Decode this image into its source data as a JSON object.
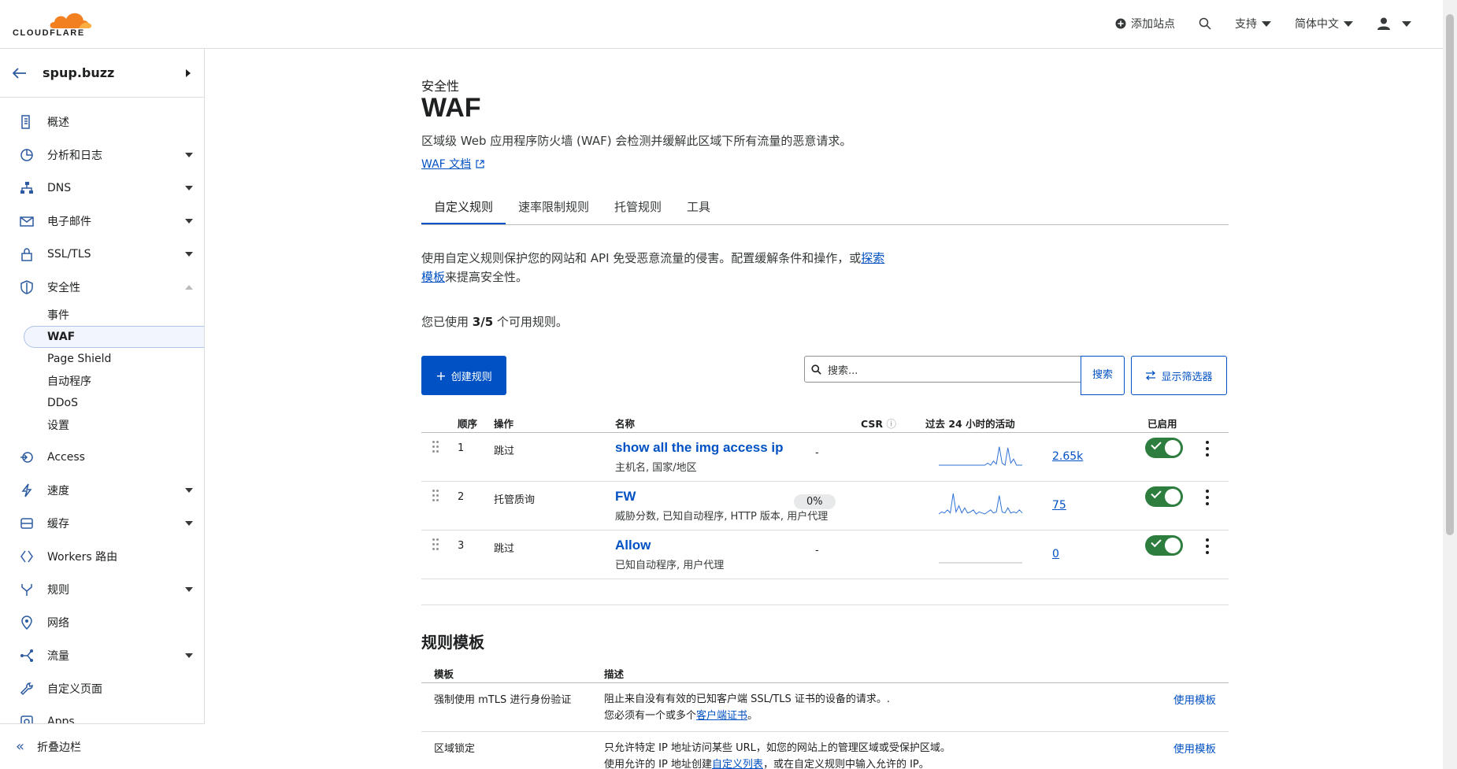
{
  "brand": {
    "logo_text": "CLOUDFLARE",
    "orange": "#f38020",
    "orange_light": "#faae40"
  },
  "topbar": {
    "add_site": "添加站点",
    "support": "支持",
    "language": "简体中文"
  },
  "sidebar": {
    "zone": "spup.buzz",
    "items": [
      {
        "label": "概述",
        "icon": "document-icon",
        "expand": ""
      },
      {
        "label": "分析和日志",
        "icon": "chart-icon",
        "expand": "down"
      },
      {
        "label": "DNS",
        "icon": "network-icon",
        "expand": "down"
      },
      {
        "label": "电子邮件",
        "icon": "mail-icon",
        "expand": "down"
      },
      {
        "label": "SSL/TLS",
        "icon": "lock-icon",
        "expand": "down"
      },
      {
        "label": "安全性",
        "icon": "shield-icon",
        "expand": "up"
      }
    ],
    "security_sub": [
      "事件",
      "WAF",
      "Page Shield",
      "自动程序",
      "DDoS",
      "设置"
    ],
    "items_after": [
      {
        "label": "Access",
        "icon": "access-icon",
        "expand": ""
      },
      {
        "label": "速度",
        "icon": "bolt-icon",
        "expand": "down"
      },
      {
        "label": "缓存",
        "icon": "cache-icon",
        "expand": "down"
      },
      {
        "label": "Workers 路由",
        "icon": "workers-icon",
        "expand": ""
      },
      {
        "label": "规则",
        "icon": "rules-icon",
        "expand": "down"
      },
      {
        "label": "网络",
        "icon": "location-icon",
        "expand": ""
      },
      {
        "label": "流量",
        "icon": "traffic-icon",
        "expand": "down"
      },
      {
        "label": "自定义页面",
        "icon": "wrench-icon",
        "expand": ""
      },
      {
        "label": "Apps",
        "icon": "apps-icon",
        "expand": ""
      }
    ],
    "collapse": "折叠边栏"
  },
  "page": {
    "breadcrumb": "安全性",
    "title": "WAF",
    "description": "区域级 Web 应用程序防火墙 (WAF) 会检测并缓解此区域下所有流量的恶意请求。",
    "doc_link": "WAF 文档",
    "tabs": [
      "自定义规则",
      "速率限制规则",
      "托管规则",
      "工具"
    ],
    "intro_a": "使用自定义规则保护您的网站和 API 免受恶意流量的侵害。配置缓解条件和操作，或",
    "intro_link_1": "探索",
    "intro_link_2": "模板",
    "intro_b": "来提高安全性。",
    "usage_prefix": "您已使用 ",
    "usage_value": "3/5",
    "usage_suffix": " 个可用规则。",
    "create_button": "创建规则",
    "search_placeholder": "搜索...",
    "search_button": "搜索",
    "filter_button": "显示筛选器"
  },
  "rules": {
    "headers": {
      "order": "顺序",
      "action": "操作",
      "name": "名称",
      "csr": "CSR",
      "activity": "过去 24 小时的活动",
      "enabled": "已启用"
    },
    "rows": [
      {
        "order": "1",
        "action": "跳过",
        "name": "show all the img access ip",
        "sub": "主机名, 国家/地区",
        "csr": "-",
        "count": "2.65k",
        "enabled": true,
        "spark": [
          0,
          0,
          0,
          0,
          0,
          0,
          0,
          0,
          0,
          0,
          0,
          0,
          0,
          0,
          0,
          0,
          0,
          0.1,
          0,
          0.2,
          0.05,
          0.9,
          0.1,
          0,
          0.85,
          0.1,
          0.3,
          0,
          0,
          0
        ],
        "csr_pill": false
      },
      {
        "order": "2",
        "action": "托管质询",
        "name": "FW",
        "sub": "威胁分数, 已知自动程序, HTTP 版本, 用户代理",
        "csr": "0%",
        "count": "75",
        "enabled": true,
        "spark": [
          0,
          0.1,
          0.05,
          0.2,
          0.05,
          1,
          0.1,
          0.4,
          0.05,
          0.3,
          0.05,
          0.1,
          0.2,
          0,
          0.1,
          0.05,
          0,
          0.1,
          0.2,
          0.05,
          0.1,
          0.9,
          0.1,
          0.05,
          0.3,
          0.05,
          0.1,
          0.05,
          0.2,
          0.05
        ],
        "csr_pill": true
      },
      {
        "order": "3",
        "action": "跳过",
        "name": "Allow",
        "sub": "已知自动程序, 用户代理",
        "csr": "-",
        "count": "0",
        "enabled": true,
        "spark": [
          0,
          0,
          0,
          0,
          0,
          0,
          0,
          0,
          0,
          0,
          0,
          0,
          0,
          0,
          0,
          0,
          0,
          0,
          0,
          0,
          0,
          0,
          0,
          0,
          0,
          0,
          0,
          0,
          0,
          0
        ],
        "csr_pill": false
      }
    ]
  },
  "templates": {
    "title": "规则模板",
    "headers": {
      "template": "模板",
      "description": "描述"
    },
    "rows": [
      {
        "name": "强制使用 mTLS 进行身份验证",
        "line1": "阻止来自没有有效的已知客户端 SSL/TLS 证书的设备的请求。.",
        "line2_a": "您必须有一个或多个",
        "line2_link": "客户端证书",
        "line2_b": "。",
        "action": "使用模板"
      },
      {
        "name": "区域锁定",
        "line1": "只允许特定 IP 地址访问某些 URL，如您的网站上的管理区域或受保护区域。",
        "line2_a": "使用允许的 IP 地址创建",
        "line2_link": "自定义列表",
        "line2_b": "，或在自定义规则中输入允许的 IP。",
        "action": "使用模板"
      }
    ]
  },
  "colors": {
    "accent": "#0051c3",
    "toggle_on": "#2d7d3f",
    "spark": "#2f72d8"
  }
}
